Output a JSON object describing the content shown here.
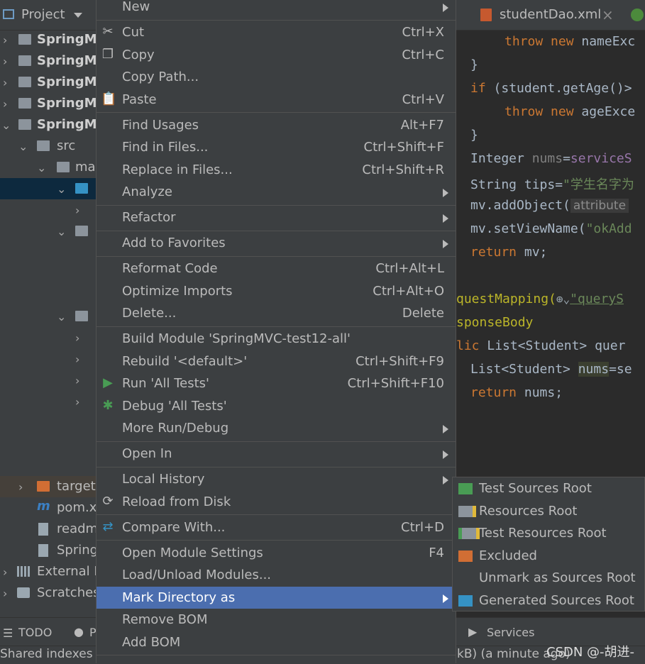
{
  "project_panel": {
    "title": "Project",
    "tree": [
      {
        "label": "SpringMVC-"
      },
      {
        "label": "SpringMVC-"
      },
      {
        "label": "SpringMVC-"
      },
      {
        "label": "SpringMVC-"
      },
      {
        "label": "SpringMVC-"
      },
      {
        "label": "src"
      },
      {
        "label": "main"
      },
      {
        "label": "target"
      },
      {
        "label": "pom.xml"
      },
      {
        "label": "readme"
      },
      {
        "label": "Spring"
      },
      {
        "label": "External Libraries"
      },
      {
        "label": "Scratches"
      }
    ]
  },
  "editor": {
    "tab_label": "studentDao.xml",
    "tab_close": "×",
    "lines": {
      "l1_kw": "throw new ",
      "l1_rest": "nameExc",
      "l2": "}",
      "l3_kw": "if ",
      "l3_rest": "(student.getAge()>",
      "l4_kw": "throw new ",
      "l4_rest": "ageExce",
      "l5": "}",
      "l6_a": "Integer ",
      "l6_b": "nums",
      "l6_c": "=",
      "l6_d": "serviceS",
      "l7_a": "String tips=",
      "l7_b": "\"学生名字为",
      "l8_a": "mv.addObject(",
      "l8_hint": "attribute",
      "l9_a": "mv.setViewName(",
      "l9_b": "\"okAdd",
      "l10_kw": "return ",
      "l10_rest": "mv;",
      "l11_a": "questMapping(",
      "l11_b": "\"queryS",
      "l12": "sponseBody",
      "l13_kw": "lic ",
      "l13_rest": "List<Student> quer",
      "l14_a": "List<Student> ",
      "l14_b": "nums",
      "l14_c": "=se",
      "l15_kw": "return ",
      "l15_rest": "nums;"
    }
  },
  "context_menu": {
    "items": {
      "new": {
        "label": "New"
      },
      "cut": {
        "label": "Cut",
        "shortcut": "Ctrl+X"
      },
      "copy": {
        "label": "Copy",
        "shortcut": "Ctrl+C"
      },
      "copy_path": {
        "label": "Copy Path..."
      },
      "paste": {
        "label": "Paste",
        "shortcut": "Ctrl+V"
      },
      "find_usages": {
        "label": "Find Usages",
        "shortcut": "Alt+F7"
      },
      "find_in_files": {
        "label": "Find in Files...",
        "shortcut": "Ctrl+Shift+F"
      },
      "replace_in_files": {
        "label": "Replace in Files...",
        "shortcut": "Ctrl+Shift+R"
      },
      "analyze": {
        "label": "Analyze"
      },
      "refactor": {
        "label": "Refactor"
      },
      "add_to_favorites": {
        "label": "Add to Favorites"
      },
      "reformat_code": {
        "label": "Reformat Code",
        "shortcut": "Ctrl+Alt+L"
      },
      "optimize_imports": {
        "label": "Optimize Imports",
        "shortcut": "Ctrl+Alt+O"
      },
      "delete": {
        "label": "Delete...",
        "shortcut": "Delete"
      },
      "build_module": {
        "label": "Build Module 'SpringMVC-test12-all'"
      },
      "rebuild": {
        "label": "Rebuild '<default>'",
        "shortcut": "Ctrl+Shift+F9"
      },
      "run_tests": {
        "label": "Run 'All Tests'",
        "shortcut": "Ctrl+Shift+F10"
      },
      "debug_tests": {
        "label": "Debug 'All Tests'"
      },
      "more_run_debug": {
        "label": "More Run/Debug"
      },
      "open_in": {
        "label": "Open In"
      },
      "local_history": {
        "label": "Local History"
      },
      "reload_from_disk": {
        "label": "Reload from Disk"
      },
      "compare_with": {
        "label": "Compare With...",
        "shortcut": "Ctrl+D"
      },
      "open_module_settings": {
        "label": "Open Module Settings",
        "shortcut": "F4"
      },
      "load_unload_modules": {
        "label": "Load/Unload Modules..."
      },
      "mark_directory_as": {
        "label": "Mark Directory as"
      },
      "remove_bom": {
        "label": "Remove BOM"
      },
      "add_bom": {
        "label": "Add BOM"
      }
    }
  },
  "submenu": {
    "items": [
      {
        "label": "Test Sources Root",
        "icon": "green-folder-icon"
      },
      {
        "label": "Resources Root",
        "icon": "resources-folder-icon"
      },
      {
        "label": "Test Resources Root",
        "icon": "test-resources-folder-icon"
      },
      {
        "label": "Excluded",
        "icon": "orange-folder-icon"
      },
      {
        "label": "Unmark as Sources Root",
        "icon": ""
      },
      {
        "label": "Generated Sources Root",
        "icon": "generated-folder-icon"
      }
    ]
  },
  "bottom_bar": {
    "todo": "TODO",
    "problems_initial": "P",
    "services": "Services"
  },
  "status_bar": {
    "left": "Shared indexes",
    "right": "kB) (a minute ago)"
  },
  "watermark": "CSDN @-胡进-",
  "colors": {
    "selection": "#4b6eaf",
    "keyword": "#cc7832",
    "string": "#6a8759",
    "field": "#9876aa",
    "panel": "#3c3f41"
  }
}
